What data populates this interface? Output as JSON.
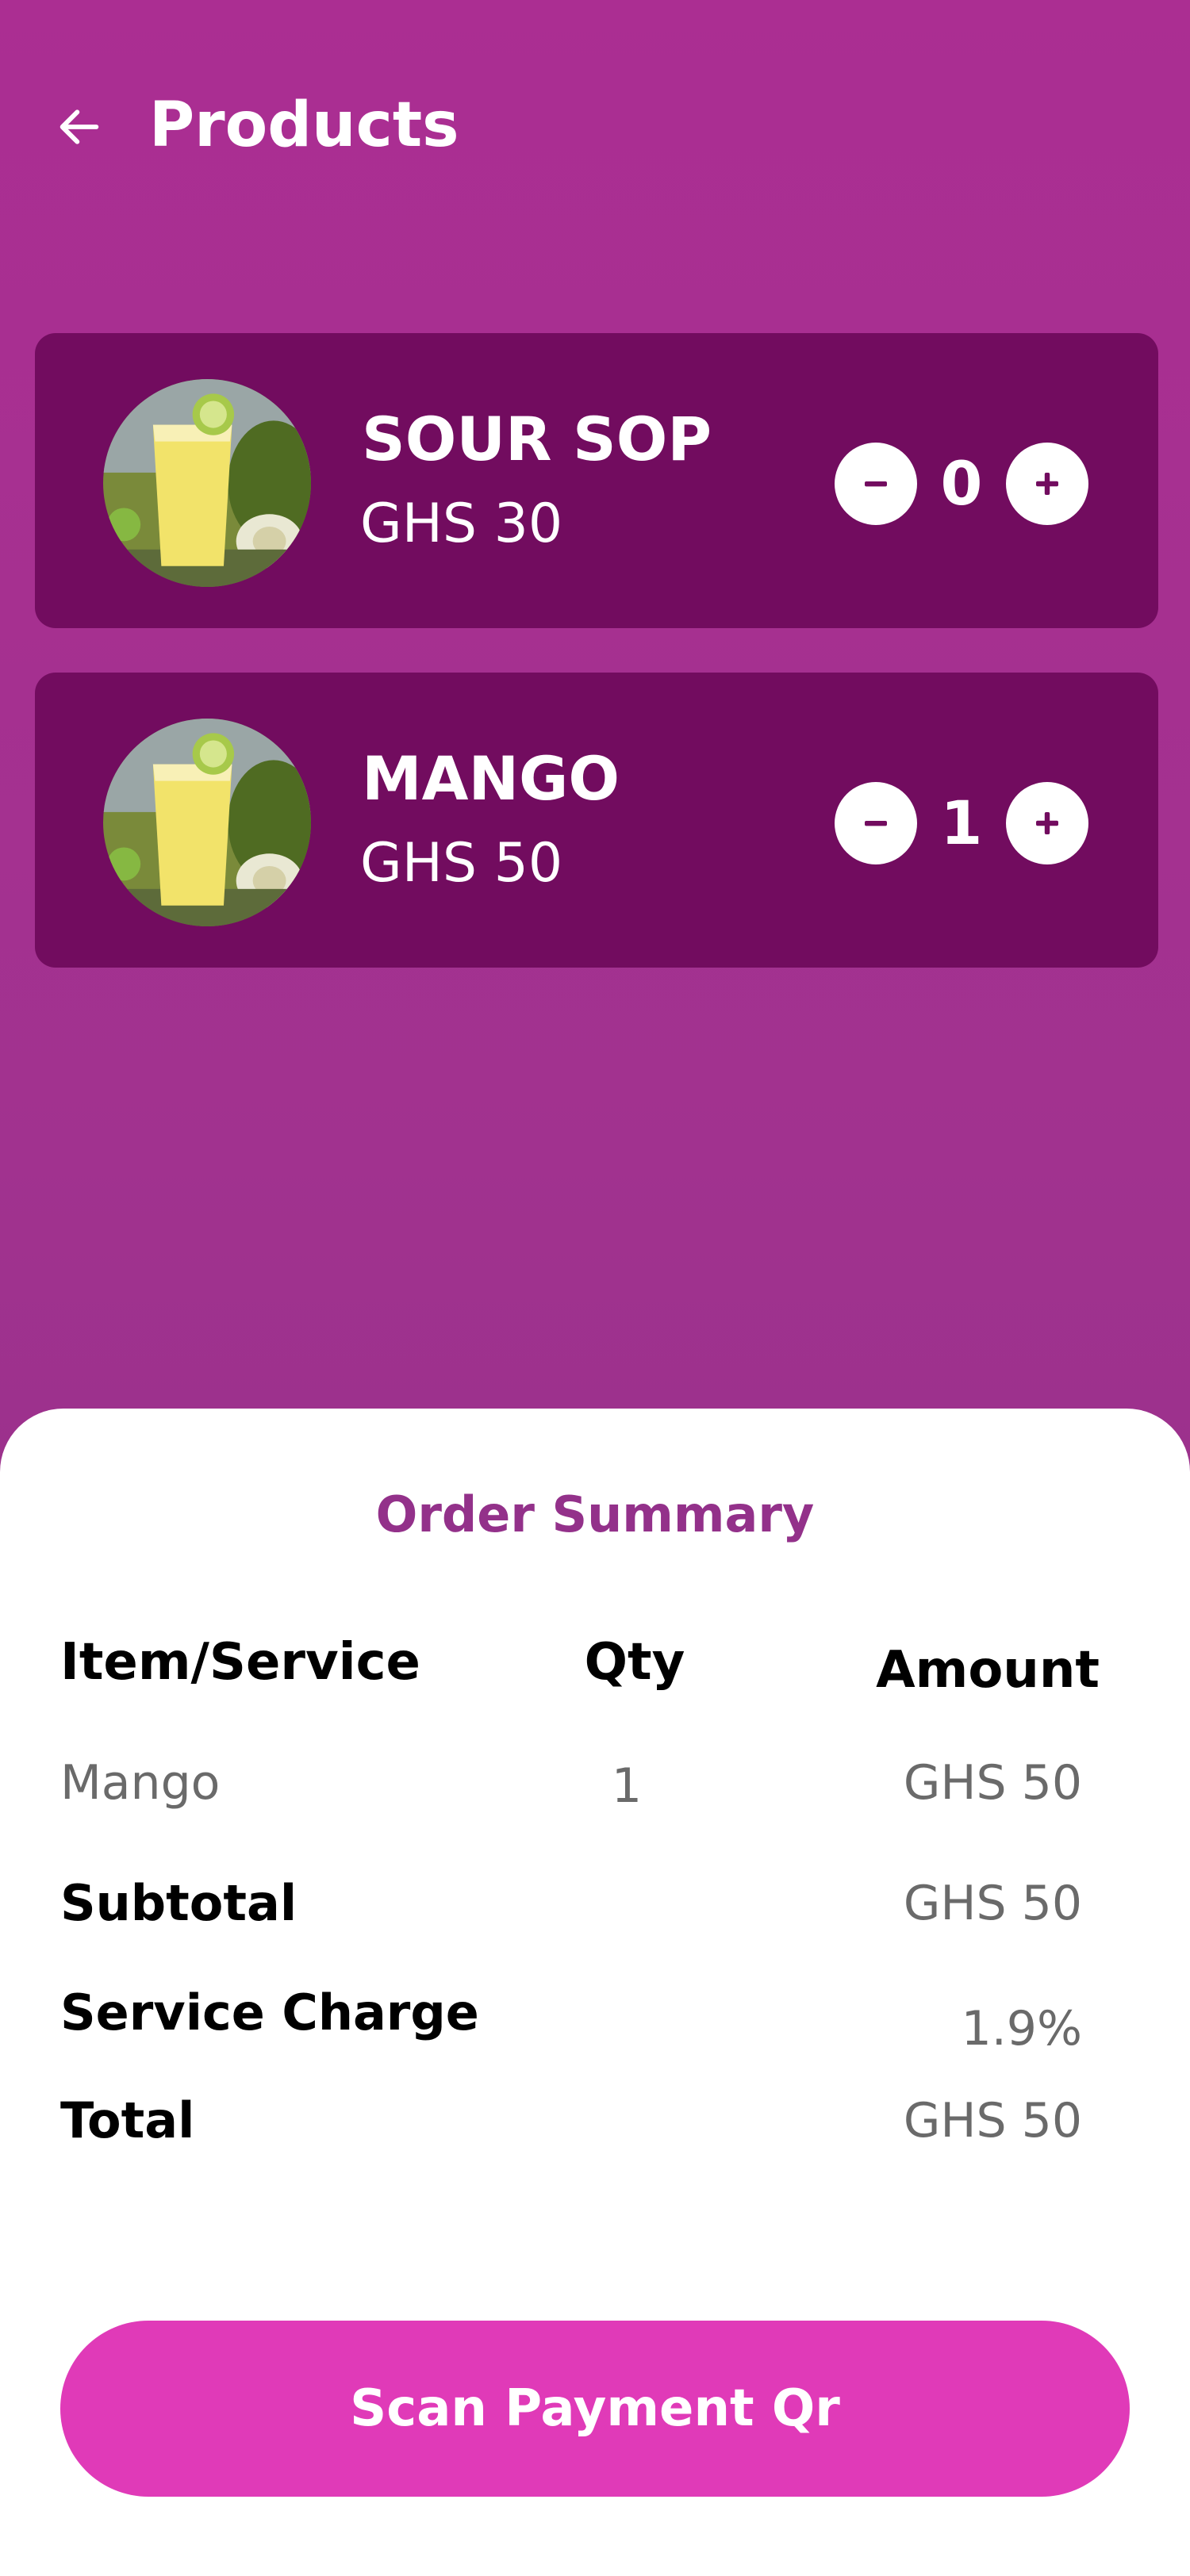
{
  "header": {
    "title": "Products",
    "back_icon": "arrow-left-icon"
  },
  "products": [
    {
      "name": "SOUR SOP",
      "price": "GHS 30",
      "quantity": "0",
      "image": "soursop-juice-image"
    },
    {
      "name": "MANGO",
      "price": "GHS 50",
      "quantity": "1",
      "image": "mango-juice-image"
    }
  ],
  "summary": {
    "title": "Order Summary",
    "columns": {
      "item": "Item/Service",
      "qty": "Qty",
      "amount": "Amount"
    },
    "items": [
      {
        "item": "Mango",
        "qty": "1",
        "amount": "GHS 50"
      }
    ],
    "subtotal_label": "Subtotal",
    "subtotal_value": "GHS 50",
    "service_charge_label": "Service Charge",
    "service_charge_value": "1.9%",
    "total_label": "Total",
    "total_value": "GHS 50"
  },
  "actions": {
    "scan_payment_label": "Scan Payment Qr"
  },
  "colors": {
    "background_top": "#ab2e92",
    "background_bottom": "#8a2d83",
    "card": "#720c5f",
    "summary_title": "#93318a",
    "primary_button": "#e03ab8"
  }
}
